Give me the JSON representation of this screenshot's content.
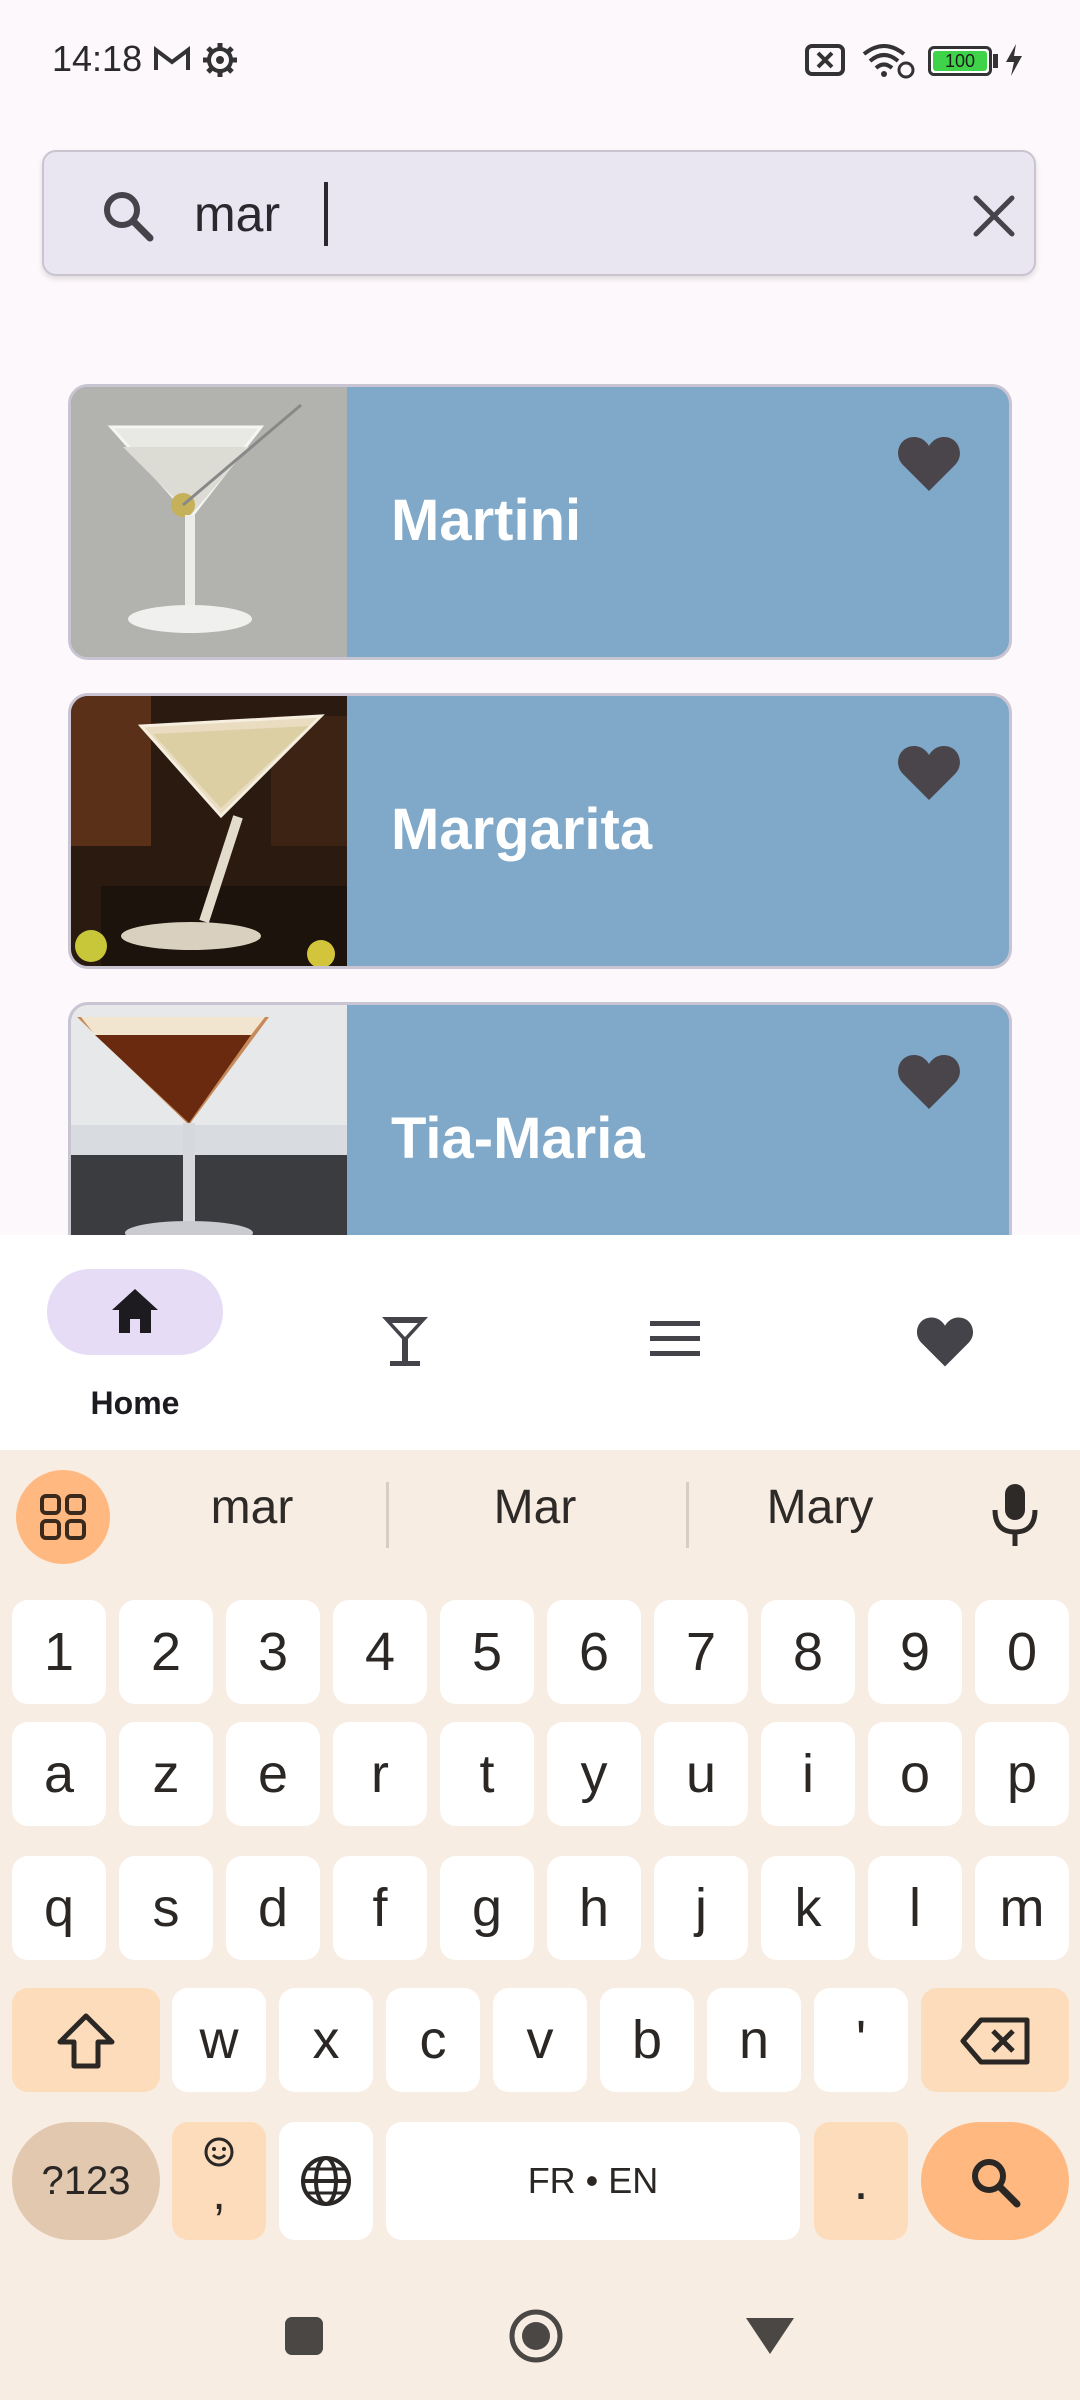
{
  "status_bar": {
    "time": "14:18",
    "battery_level": "100"
  },
  "search": {
    "value": "mar",
    "placeholder": ""
  },
  "cocktails": [
    {
      "name": "Martini",
      "favorite": true
    },
    {
      "name": "Margarita",
      "favorite": true
    },
    {
      "name": "Tia-Maria",
      "favorite": true
    }
  ],
  "bottom_nav": {
    "home_label": "Home",
    "items": [
      "home-icon",
      "cocktail-glass-icon",
      "menu-icon",
      "heart-icon"
    ],
    "active": "Home"
  },
  "keyboard": {
    "suggestions": [
      "mar",
      "Mar",
      "Mary"
    ],
    "number_row": [
      "1",
      "2",
      "3",
      "4",
      "5",
      "6",
      "7",
      "8",
      "9",
      "0"
    ],
    "row1": [
      "a",
      "z",
      "e",
      "r",
      "t",
      "y",
      "u",
      "i",
      "o",
      "p"
    ],
    "row2": [
      "q",
      "s",
      "d",
      "f",
      "g",
      "h",
      "j",
      "k",
      "l",
      "m"
    ],
    "row3": [
      "w",
      "x",
      "c",
      "v",
      "b",
      "n",
      "'"
    ],
    "symbols_key": "?123",
    "emoji_comma": ",",
    "space_label": "FR • EN",
    "period": "."
  },
  "colors": {
    "card": "#7fa8c9",
    "accent_orange": "#ffb980",
    "nav_pill": "#e6dcf6",
    "battery_green": "#3fd34a"
  }
}
